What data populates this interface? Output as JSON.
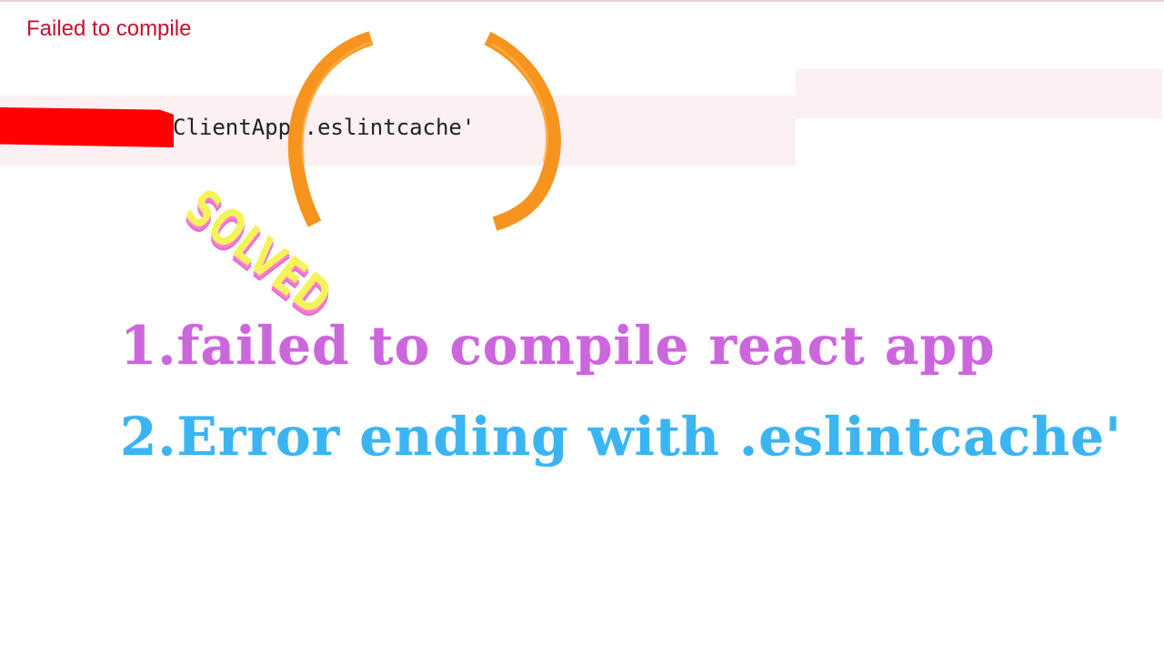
{
  "error": {
    "title": "Failed to compile",
    "path_text": "ClientApp\\.eslintcache'"
  },
  "stamp": {
    "text": "SOLVED"
  },
  "headlines": [
    "1.failed to compile react app",
    "2.Error ending with .eslintcache'"
  ],
  "colors": {
    "error_red": "#c8102e",
    "error_background": "#fcf0f2",
    "redaction": "#ff0000",
    "bracket_orange": "#f7941d",
    "stamp_yellow": "#f4f35a",
    "stamp_pink": "#ff7ad9",
    "headline_purple": "#cc66dd",
    "headline_blue": "#3bb5f2"
  }
}
